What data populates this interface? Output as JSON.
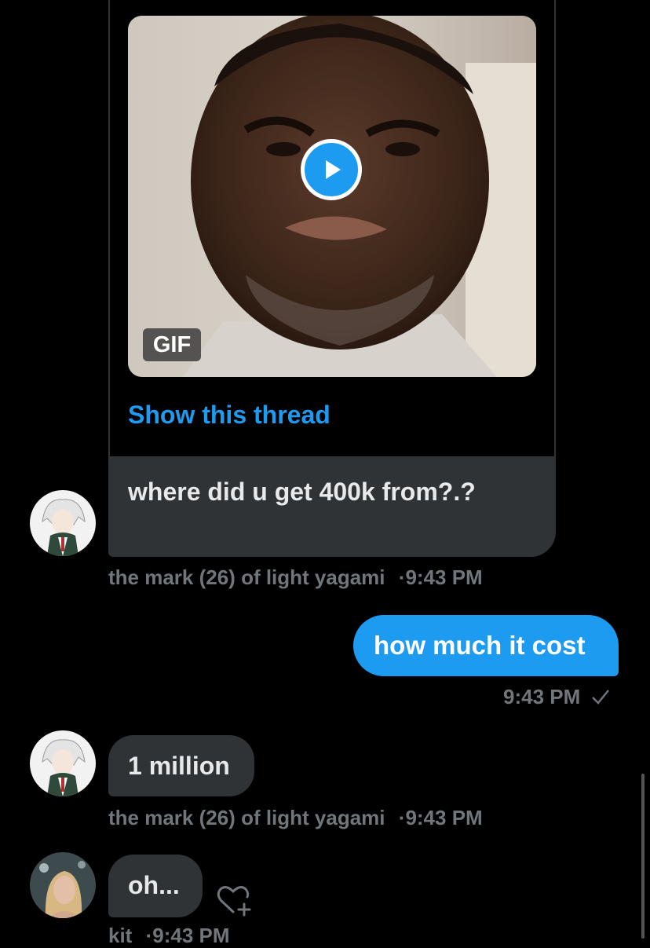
{
  "tweet_card": {
    "media_badge": "GIF",
    "show_thread_label": "Show this thread"
  },
  "messages": [
    {
      "text": "where did u get 400k from?.?",
      "sender": "the mark (26) of light yagami",
      "time": "9:43 PM"
    },
    {
      "text": "how much it cost",
      "time": "9:43 PM",
      "direction": "outgoing"
    },
    {
      "text": "1 million",
      "sender": "the mark (26) of light yagami",
      "time": "9:43 PM"
    },
    {
      "text": "oh...",
      "sender": "kit",
      "time": "9:43 PM"
    }
  ],
  "separator": "·",
  "colors": {
    "accent": "#1d9bf0",
    "bubble_in": "#2f3336",
    "background": "#000000",
    "meta": "#71767b"
  },
  "icons": [
    "play-icon",
    "checkmark-icon",
    "heart-add-icon"
  ]
}
